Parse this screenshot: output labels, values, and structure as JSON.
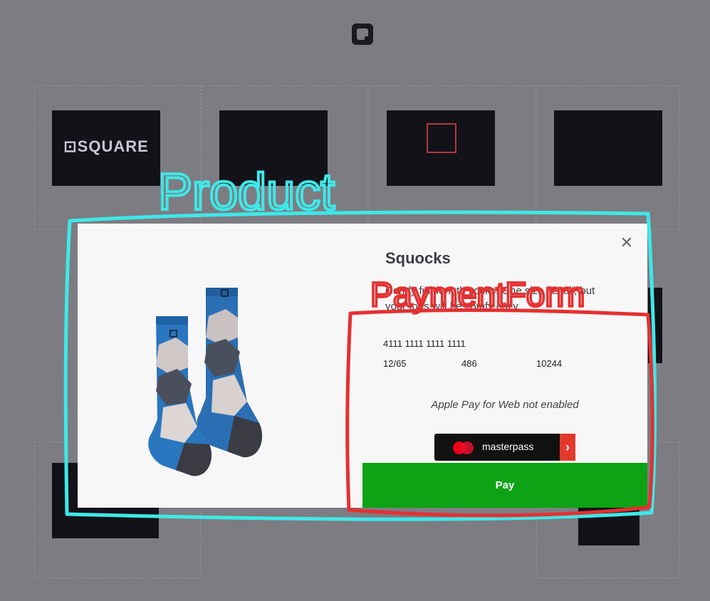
{
  "background_color": "#7d7c82",
  "header": {
    "logo_icon": "square-logo-icon"
  },
  "gallery": {
    "thumbnails": [
      {
        "label": "⊡SQUARE"
      },
      {
        "label": ""
      },
      {
        "label": ""
      },
      {
        "label": ""
      }
    ]
  },
  "modal": {
    "title": "Squocks",
    "description": "Comfy full-length socks. One size fits all, but your toes will be comfy cozy.",
    "close_icon": "close-icon",
    "payment": {
      "card_number": "4111 1111 1111 1111",
      "expiration": "12/65",
      "cvv": "486",
      "postal_code": "10244",
      "apple_pay_message": "Apple Pay for Web not enabled",
      "masterpass_label": "masterpass",
      "pay_label": "Pay",
      "pay_color": "#0da315"
    }
  },
  "annotations": {
    "product_label": "Product",
    "payment_label": "PaymentForm",
    "product_color": "#3ee8e8",
    "payment_color": "#e53030"
  }
}
